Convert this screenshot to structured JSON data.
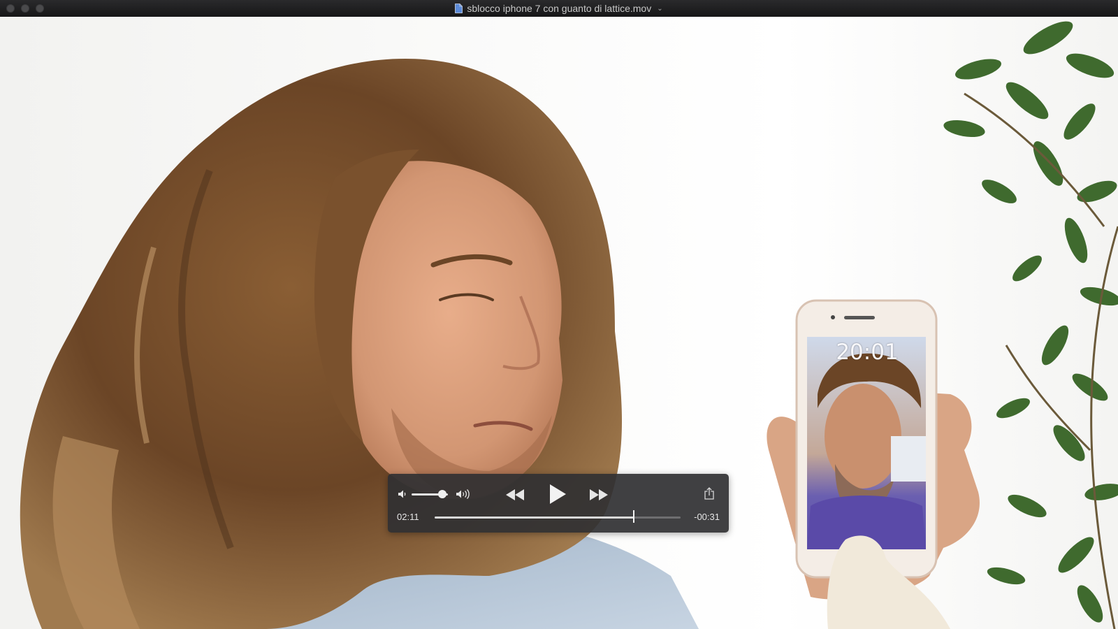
{
  "window": {
    "title": "sblocco iphone 7 con guanto di lattice.mov"
  },
  "video": {
    "phone_clock": "20:01"
  },
  "controls": {
    "elapsed": "02:11",
    "remaining": "-00:31",
    "progress": 0.81,
    "volume": 0.85
  },
  "icons": {
    "volume_low": "speaker-low-icon",
    "volume_high": "speaker-high-icon",
    "rewind": "rewind-icon",
    "play": "play-icon",
    "fast_forward": "fast-forward-icon",
    "share": "share-icon"
  },
  "colors": {
    "titlebar": "#1e1e20",
    "controls_bg": "#303032",
    "control_fg": "#e6e6e6"
  }
}
